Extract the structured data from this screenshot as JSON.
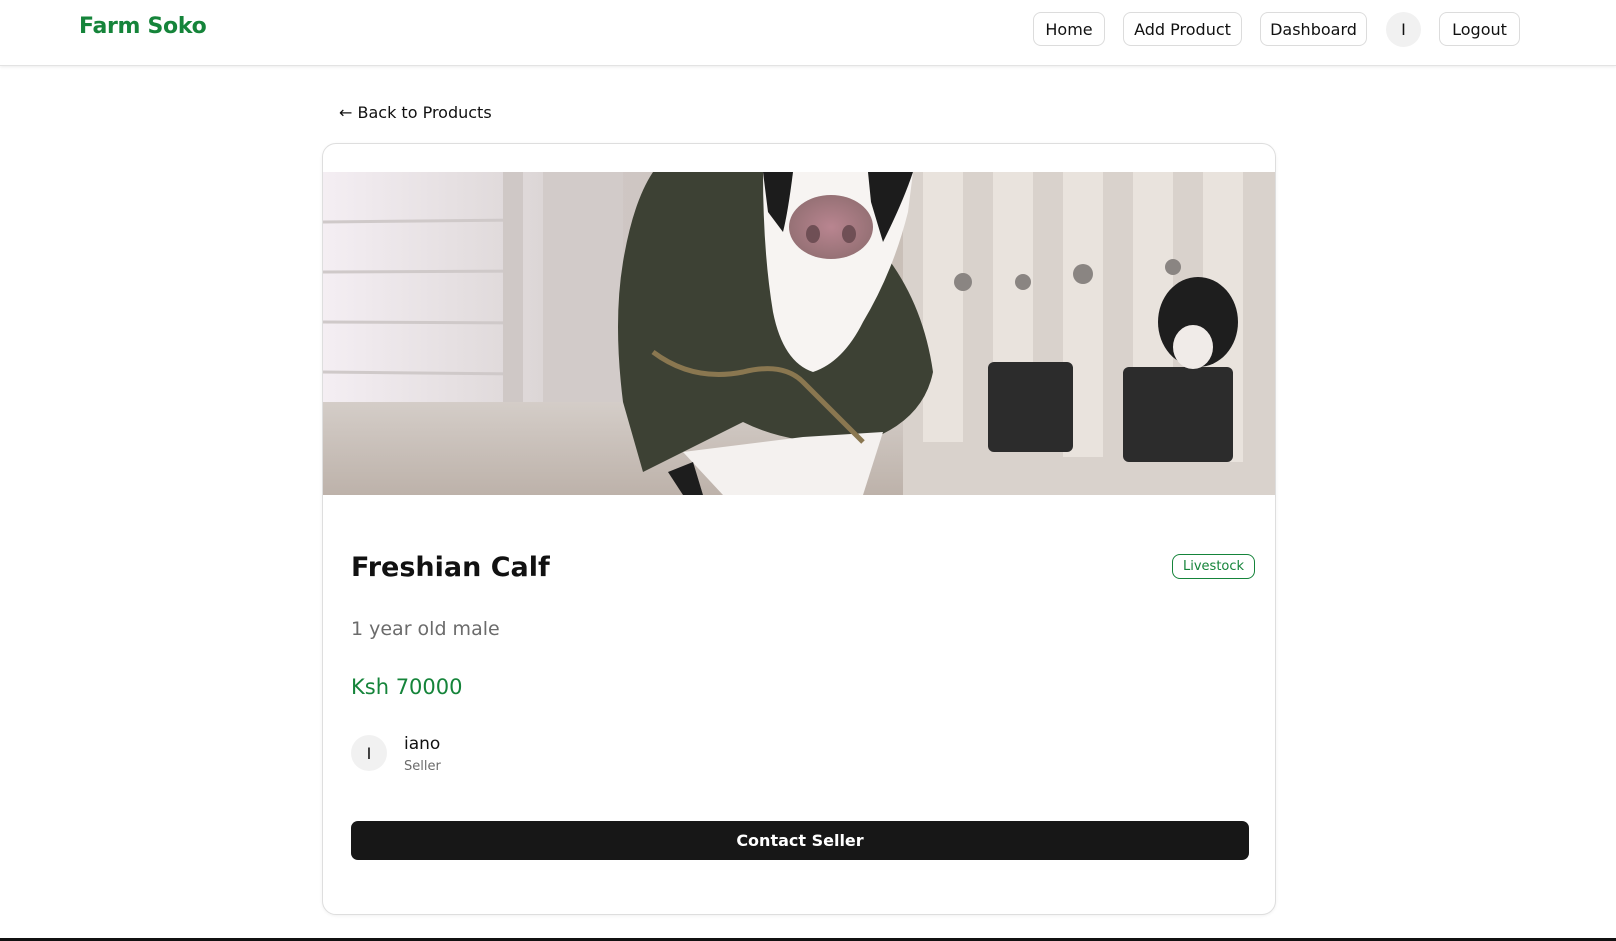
{
  "navbar": {
    "brand": "Farm Soko",
    "home_label": "Home",
    "add_product_label": "Add Product",
    "dashboard_label": "Dashboard",
    "user_initial": "I",
    "logout_label": "Logout"
  },
  "back_link": {
    "label": "← Back to Products"
  },
  "product": {
    "title": "Freshian Calf",
    "category": "Livestock",
    "description": "1 year old male",
    "price": "Ksh 70000",
    "image_alt": "calf-photo"
  },
  "seller": {
    "initial": "I",
    "name": "iano",
    "role": "Seller"
  },
  "actions": {
    "contact_label": "Contact Seller"
  },
  "colors": {
    "brand_green": "#15843a",
    "button_dark": "#171717"
  }
}
